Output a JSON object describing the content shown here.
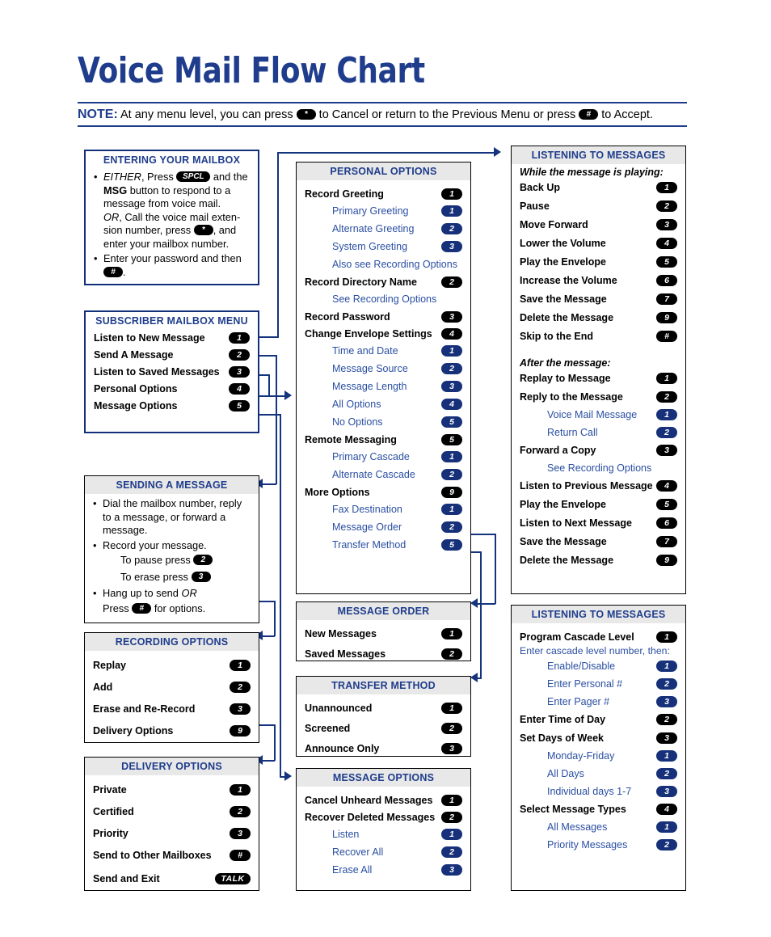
{
  "header": {
    "title": "Voice Mail Flow Chart",
    "note_label": "NOTE:",
    "note_part1": "At any menu level, you can press",
    "note_key_cancel": "*",
    "note_part2": "to Cancel or return to the Previous Menu or press",
    "note_key_accept": "#",
    "note_part3": "to Accept."
  },
  "entering_mailbox": {
    "title": "ENTERING YOUR MAILBOX",
    "b1_either": "EITHER",
    "b1_a": ", Press",
    "b1_key": "SPCL",
    "b1_b": "and the",
    "b1_msg": "MSG",
    "b1_c": "button to respond to a message from voice mail.",
    "b1_or": "OR",
    "b1_d": ", Call the voice mail exten-sion number, press",
    "b1_key2": "*",
    "b1_e": ", and enter your mailbox number.",
    "b2_a": "Enter your password and then",
    "b2_key": "#",
    "b2_b": "."
  },
  "subscriber_menu": {
    "title": "SUBSCRIBER MAILBOX MENU",
    "items": [
      {
        "label": "Listen to New Message",
        "key": "1"
      },
      {
        "label": "Send A Message",
        "key": "2"
      },
      {
        "label": "Listen to Saved Messages",
        "key": "3"
      },
      {
        "label": "Personal Options",
        "key": "4"
      },
      {
        "label": "Message Options",
        "key": "5"
      }
    ]
  },
  "sending_message": {
    "title": "SENDING A MESSAGE",
    "b1": "Dial the mailbox number, reply to a message, or forward a message.",
    "b2": "Record your message.",
    "pause_text": "To pause press",
    "pause_key": "2",
    "erase_text": "To erase press",
    "erase_key": "3",
    "b3_a": "Hang up to send",
    "b3_or": "OR",
    "b4_a": "Press",
    "b4_key": "#",
    "b4_b": "for options."
  },
  "recording_options": {
    "title": "RECORDING OPTIONS",
    "items": [
      {
        "label": "Replay",
        "key": "1"
      },
      {
        "label": "Add",
        "key": "2"
      },
      {
        "label": "Erase and Re-Record",
        "key": "3"
      },
      {
        "label": "Delivery Options",
        "key": "9"
      }
    ]
  },
  "delivery_options": {
    "title": "DELIVERY OPTIONS",
    "items": [
      {
        "label": "Private",
        "key": "1"
      },
      {
        "label": "Certified",
        "key": "2"
      },
      {
        "label": "Priority",
        "key": "3"
      },
      {
        "label": "Send to Other Mailboxes",
        "key": "#"
      }
    ],
    "send_exit_label": "Send and Exit",
    "send_exit_key": "TALK"
  },
  "personal_options": {
    "title": "PERSONAL OPTIONS",
    "items": [
      {
        "label": "Record Greeting",
        "key": "1",
        "level": "main"
      },
      {
        "label": "Primary Greeting",
        "key": "1",
        "level": "sub"
      },
      {
        "label": "Alternate Greeting",
        "key": "2",
        "level": "sub"
      },
      {
        "label": "System Greeting",
        "key": "3",
        "level": "sub"
      },
      {
        "label": "Also see Recording Options",
        "key": "",
        "level": "sub"
      },
      {
        "label": "Record Directory Name",
        "key": "2",
        "level": "main"
      },
      {
        "label": "See Recording Options",
        "key": "",
        "level": "sub"
      },
      {
        "label": "Record Password",
        "key": "3",
        "level": "main"
      },
      {
        "label": "Change Envelope Settings",
        "key": "4",
        "level": "main"
      },
      {
        "label": "Time and Date",
        "key": "1",
        "level": "sub"
      },
      {
        "label": "Message Source",
        "key": "2",
        "level": "sub"
      },
      {
        "label": "Message Length",
        "key": "3",
        "level": "sub"
      },
      {
        "label": "All Options",
        "key": "4",
        "level": "sub"
      },
      {
        "label": "No Options",
        "key": "5",
        "level": "sub"
      },
      {
        "label": "Remote Messaging",
        "key": "5",
        "level": "main"
      },
      {
        "label": "Primary Cascade",
        "key": "1",
        "level": "sub"
      },
      {
        "label": "Alternate Cascade",
        "key": "2",
        "level": "sub"
      },
      {
        "label": "More Options",
        "key": "9",
        "level": "main"
      },
      {
        "label": "Fax Destination",
        "key": "1",
        "level": "sub"
      },
      {
        "label": "Message Order",
        "key": "2",
        "level": "sub"
      },
      {
        "label": "Transfer Method",
        "key": "5",
        "level": "sub"
      }
    ]
  },
  "message_order": {
    "title": "MESSAGE ORDER",
    "items": [
      {
        "label": "New Messages",
        "key": "1"
      },
      {
        "label": "Saved Messages",
        "key": "2"
      }
    ]
  },
  "transfer_method": {
    "title": "TRANSFER METHOD",
    "items": [
      {
        "label": "Unannounced",
        "key": "1"
      },
      {
        "label": "Screened",
        "key": "2"
      },
      {
        "label": "Announce Only",
        "key": "3"
      }
    ]
  },
  "message_options": {
    "title": "MESSAGE OPTIONS",
    "items": [
      {
        "label": "Cancel Unheard Messages",
        "key": "1",
        "level": "main"
      },
      {
        "label": "Recover Deleted Messages",
        "key": "2",
        "level": "main"
      },
      {
        "label": "Listen",
        "key": "1",
        "level": "sub"
      },
      {
        "label": "Recover All",
        "key": "2",
        "level": "sub"
      },
      {
        "label": "Erase All",
        "key": "3",
        "level": "sub"
      }
    ]
  },
  "listening_messages": {
    "title": "LISTENING TO MESSAGES",
    "while_playing_header": "While the message is playing:",
    "while_playing": [
      {
        "label": "Back Up",
        "key": "1"
      },
      {
        "label": "Pause",
        "key": "2"
      },
      {
        "label": "Move Forward",
        "key": "3"
      },
      {
        "label": "Lower the Volume",
        "key": "4"
      },
      {
        "label": "Play the Envelope",
        "key": "5"
      },
      {
        "label": "Increase the Volume",
        "key": "6"
      },
      {
        "label": "Save the Message",
        "key": "7"
      },
      {
        "label": "Delete the Message",
        "key": "9"
      },
      {
        "label": "Skip to the End",
        "key": "#"
      }
    ],
    "after_message_header": "After the message:",
    "after_message": [
      {
        "label": "Replay to Message",
        "key": "1",
        "level": "main"
      },
      {
        "label": "Reply to the Message",
        "key": "2",
        "level": "main"
      },
      {
        "label": "Voice Mail Message",
        "key": "1",
        "level": "sub"
      },
      {
        "label": "Return Call",
        "key": "2",
        "level": "sub"
      },
      {
        "label": "Forward a Copy",
        "key": "3",
        "level": "main"
      },
      {
        "label": "See Recording Options",
        "key": "",
        "level": "sub"
      },
      {
        "label": "Listen to Previous Message",
        "key": "4",
        "level": "main"
      },
      {
        "label": "Play the Envelope",
        "key": "5",
        "level": "main"
      },
      {
        "label": "Listen to Next Message",
        "key": "6",
        "level": "main"
      },
      {
        "label": "Save the Message",
        "key": "7",
        "level": "main"
      },
      {
        "label": "Delete the Message",
        "key": "9",
        "level": "main"
      }
    ]
  },
  "listening_cascade": {
    "title": "LISTENING TO MESSAGES",
    "program_label": "Program Cascade Level",
    "program_key": "1",
    "cascade_note": "Enter cascade level number, then:",
    "items": [
      {
        "label": "Enable/Disable",
        "key": "1",
        "level": "sub"
      },
      {
        "label": "Enter Personal #",
        "key": "2",
        "level": "sub"
      },
      {
        "label": "Enter Pager #",
        "key": "3",
        "level": "sub"
      },
      {
        "label": "Enter Time of Day",
        "key": "2",
        "level": "main"
      },
      {
        "label": "Set Days of Week",
        "key": "3",
        "level": "main"
      },
      {
        "label": "Monday-Friday",
        "key": "1",
        "level": "sub"
      },
      {
        "label": "All Days",
        "key": "2",
        "level": "sub"
      },
      {
        "label": "Individual days 1-7",
        "key": "3",
        "level": "sub"
      },
      {
        "label": "Select Message Types",
        "key": "4",
        "level": "main"
      },
      {
        "label": "All Messages",
        "key": "1",
        "level": "sub"
      },
      {
        "label": "Priority Messages",
        "key": "2",
        "level": "sub"
      }
    ]
  },
  "colors": {
    "brand_blue": "#1f3d8c",
    "sub_blue": "#2a4fa2",
    "pill_black": "#000000",
    "pill_blue": "#16317a",
    "header_gray": "#e8e8e8"
  }
}
